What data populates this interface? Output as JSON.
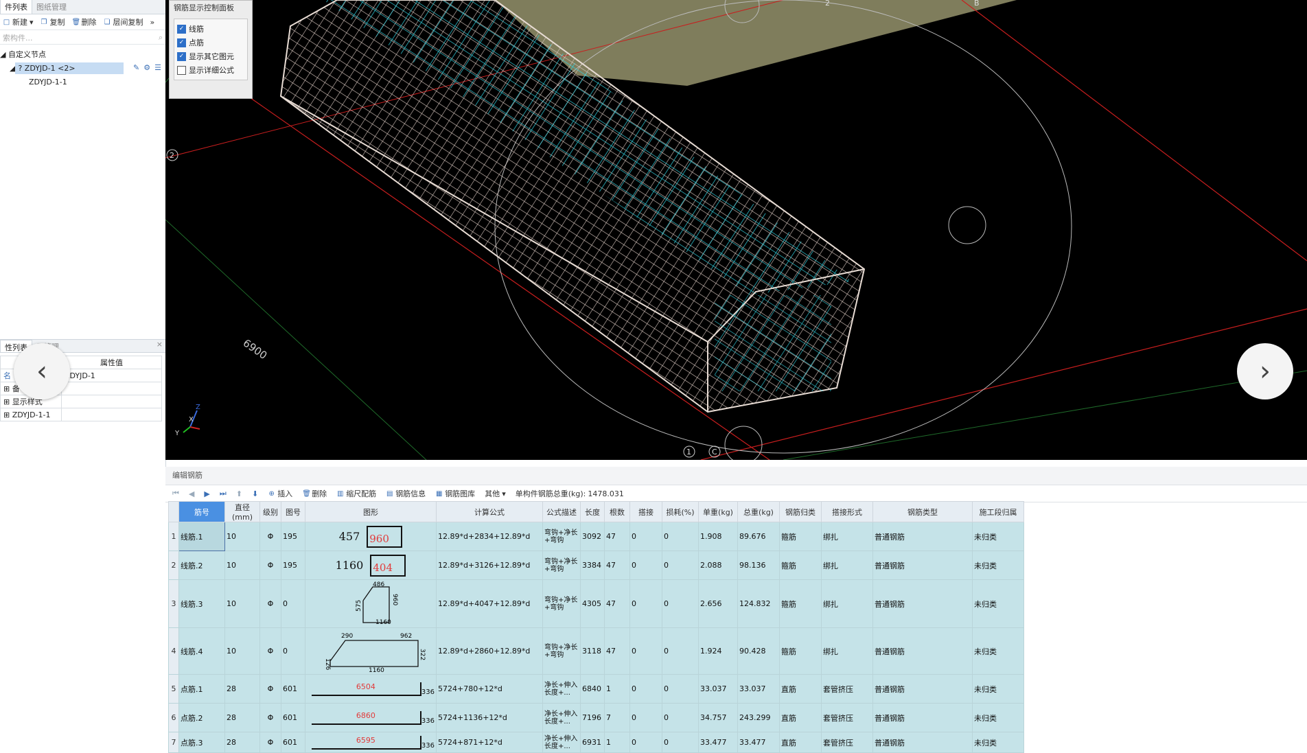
{
  "left_panel": {
    "tabs": [
      "件列表",
      "图纸管理"
    ],
    "toolbar": {
      "new": "新建",
      "copy": "复制",
      "delete": "删除",
      "layer_copy": "层间复制"
    },
    "search_placeholder": "索构件...",
    "tree": {
      "root": "自定义节点",
      "node": "? ZDYJD-1 <2>",
      "child": "ZDYJD-1-1"
    },
    "prop_tabs": [
      "性列表",
      "层管理"
    ],
    "prop_header": {
      "name": "",
      "value": "属性值"
    },
    "prop_rows": [
      {
        "name": "名",
        "value": "ZDYJD-1"
      },
      {
        "name": "备",
        "value": ""
      },
      {
        "name": "显示样式",
        "value": ""
      },
      {
        "name": "ZDYJD-1-1",
        "value": ""
      }
    ]
  },
  "control_panel": {
    "title": "钢筋显示控制面板",
    "items": [
      {
        "label": "线筋",
        "checked": true
      },
      {
        "label": "点筋",
        "checked": true
      },
      {
        "label": "显示其它图元",
        "checked": true
      },
      {
        "label": "显示详细公式",
        "checked": false
      }
    ]
  },
  "viewport": {
    "labels": {
      "grid_2": "2",
      "grid_1": "1",
      "grid_c": "C",
      "grid_top2": "2",
      "grid_b": "B",
      "dim": "6900",
      "axis_x": "X",
      "axis_y": "Y",
      "axis_z": "Z"
    },
    "colors": {
      "cage": "#d9c8c0",
      "bars": "#33d1e0",
      "slab": "#7f7d5c",
      "red_line": "#c81e1e",
      "green_line": "#1f6b2a"
    }
  },
  "editor": {
    "title": "编辑钢筋",
    "toolbar": {
      "insert": "插入",
      "delete": "删除",
      "ruler": "缩尺配筋",
      "info": "钢筋信息",
      "library": "钢筋图库",
      "other": "其他",
      "total_label": "单构件钢筋总重(kg):",
      "total_value": "1478.031"
    },
    "columns": [
      "筋号",
      "直径(mm)",
      "级别",
      "图号",
      "图形",
      "计算公式",
      "公式描述",
      "长度",
      "根数",
      "搭接",
      "损耗(%)",
      "单重(kg)",
      "总重(kg)",
      "钢筋归类",
      "搭接形式",
      "钢筋类型",
      "施工段归属"
    ],
    "rows": [
      {
        "n": "1",
        "name": "线筋.1",
        "dia": "10",
        "grade": "Φ",
        "fig": "195",
        "s1": "457",
        "s2": "960",
        "formula": "12.89*d+2834+12.89*d",
        "desc": "弯钩+净长+弯钩",
        "len": "3092",
        "cnt": "47",
        "lap": "0",
        "loss": "0",
        "unit": "1.908",
        "total": "89.676",
        "cls": "箍筋",
        "lapform": "绑扎",
        "type": "普通钢筋",
        "seg": "未归类"
      },
      {
        "n": "2",
        "name": "线筋.2",
        "dia": "10",
        "grade": "Φ",
        "fig": "195",
        "s1": "1160",
        "s2": "404",
        "formula": "12.89*d+3126+12.89*d",
        "desc": "弯钩+净长+弯钩",
        "len": "3384",
        "cnt": "47",
        "lap": "0",
        "loss": "0",
        "unit": "2.088",
        "total": "98.136",
        "cls": "箍筋",
        "lapform": "绑扎",
        "type": "普通钢筋",
        "seg": "未归类"
      },
      {
        "n": "3",
        "name": "线筋.3",
        "dia": "10",
        "grade": "Φ",
        "fig": "0",
        "s1": "486",
        "s2": "1160",
        "s3": "575",
        "s4": "960",
        "formula": "12.89*d+4047+12.89*d",
        "desc": "弯钩+净长+弯钩",
        "len": "4305",
        "cnt": "47",
        "lap": "0",
        "loss": "0",
        "unit": "2.656",
        "total": "124.832",
        "cls": "箍筋",
        "lapform": "绑扎",
        "type": "普通钢筋",
        "seg": "未归类"
      },
      {
        "n": "4",
        "name": "线筋.4",
        "dia": "10",
        "grade": "Φ",
        "fig": "0",
        "s1": "290",
        "s2": "962",
        "s3": "1160",
        "s4": "126",
        "s5": "322",
        "formula": "12.89*d+2860+12.89*d",
        "desc": "弯钩+净长+弯钩",
        "len": "3118",
        "cnt": "47",
        "lap": "0",
        "loss": "0",
        "unit": "1.924",
        "total": "90.428",
        "cls": "箍筋",
        "lapform": "绑扎",
        "type": "普通钢筋",
        "seg": "未归类"
      },
      {
        "n": "5",
        "name": "点筋.1",
        "dia": "28",
        "grade": "Φ",
        "fig": "601",
        "s1": "6504",
        "s2": "336",
        "formula": "5724+780+12*d",
        "desc": "净长+伸入长度+...",
        "len": "6840",
        "cnt": "1",
        "lap": "0",
        "loss": "0",
        "unit": "33.037",
        "total": "33.037",
        "cls": "直筋",
        "lapform": "套管挤压",
        "type": "普通钢筋",
        "seg": "未归类"
      },
      {
        "n": "6",
        "name": "点筋.2",
        "dia": "28",
        "grade": "Φ",
        "fig": "601",
        "s1": "6860",
        "s2": "336",
        "formula": "5724+1136+12*d",
        "desc": "净长+伸入长度+...",
        "len": "7196",
        "cnt": "7",
        "lap": "0",
        "loss": "0",
        "unit": "34.757",
        "total": "243.299",
        "cls": "直筋",
        "lapform": "套管挤压",
        "type": "普通钢筋",
        "seg": "未归类"
      },
      {
        "n": "7",
        "name": "点筋.3",
        "dia": "28",
        "grade": "Φ",
        "fig": "601",
        "s1": "6595",
        "s2": "336",
        "formula": "5724+871+12*d",
        "desc": "净长+伸入长度+...",
        "len": "6931",
        "cnt": "1",
        "lap": "0",
        "loss": "0",
        "unit": "33.477",
        "total": "33.477",
        "cls": "直筋",
        "lapform": "套管挤压",
        "type": "普通钢筋",
        "seg": "未归类"
      }
    ]
  }
}
